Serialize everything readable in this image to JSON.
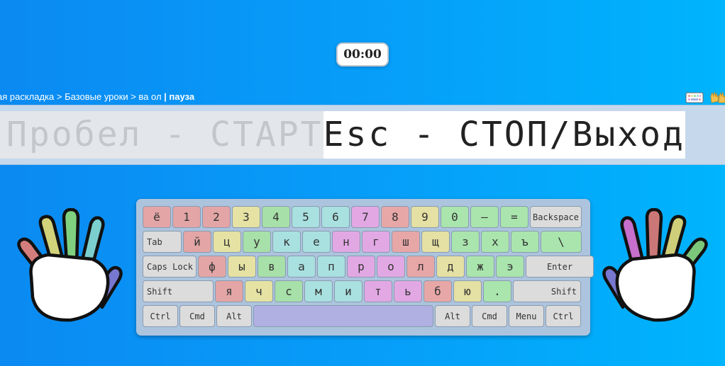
{
  "timer": "00:00",
  "breadcrumb": {
    "path": "кая раскладка > Базовые уроки > ва ол ",
    "separator": "| ",
    "state": "пауза"
  },
  "lesson": {
    "typed": "Пробел - СТАРТ ",
    "pending": "Esc - СТОП/Выход"
  },
  "finger_colors": {
    "pinky_left": "#e3a5a5",
    "ring_left": "#e5e2a3",
    "middle_left": "#a7e0a8",
    "index_left": "#a9e0e0",
    "index_right": "#e2a8e4",
    "middle_right": "#e7a7a7",
    "ring_right": "#e5e0a3",
    "pinky_right": "#a9e5ad",
    "thumb": "#b0b0e3",
    "fn": "#dcdcdc"
  },
  "keyboard": {
    "rows": [
      [
        {
          "label": "ё",
          "finger": "pinky_left"
        },
        {
          "label": "1",
          "finger": "pinky_left"
        },
        {
          "label": "2",
          "finger": "pinky_left"
        },
        {
          "label": "3",
          "finger": "ring_left"
        },
        {
          "label": "4",
          "finger": "middle_left"
        },
        {
          "label": "5",
          "finger": "index_left"
        },
        {
          "label": "6",
          "finger": "index_left"
        },
        {
          "label": "7",
          "finger": "index_right"
        },
        {
          "label": "8",
          "finger": "middle_right"
        },
        {
          "label": "9",
          "finger": "ring_right"
        },
        {
          "label": "0",
          "finger": "pinky_right"
        },
        {
          "label": "–",
          "finger": "pinky_right"
        },
        {
          "label": "=",
          "finger": "pinky_right"
        },
        {
          "label": "Backspace",
          "finger": "fn",
          "wide": true
        }
      ],
      [
        {
          "label": "Tab",
          "finger": "fn",
          "wide": true
        },
        {
          "label": "й",
          "finger": "pinky_left"
        },
        {
          "label": "ц",
          "finger": "ring_left"
        },
        {
          "label": "у",
          "finger": "middle_left"
        },
        {
          "label": "к",
          "finger": "index_left"
        },
        {
          "label": "е",
          "finger": "index_left"
        },
        {
          "label": "н",
          "finger": "index_right"
        },
        {
          "label": "г",
          "finger": "index_right"
        },
        {
          "label": "ш",
          "finger": "middle_right"
        },
        {
          "label": "щ",
          "finger": "ring_right"
        },
        {
          "label": "з",
          "finger": "pinky_right"
        },
        {
          "label": "х",
          "finger": "pinky_right"
        },
        {
          "label": "ъ",
          "finger": "pinky_right"
        },
        {
          "label": "\\",
          "finger": "pinky_right",
          "wide": true
        }
      ],
      [
        {
          "label": "Caps Lock",
          "finger": "fn",
          "wide": true
        },
        {
          "label": "ф",
          "finger": "pinky_left"
        },
        {
          "label": "ы",
          "finger": "ring_left"
        },
        {
          "label": "в",
          "finger": "middle_left"
        },
        {
          "label": "а",
          "finger": "index_left"
        },
        {
          "label": "п",
          "finger": "index_left"
        },
        {
          "label": "р",
          "finger": "index_right"
        },
        {
          "label": "о",
          "finger": "index_right"
        },
        {
          "label": "л",
          "finger": "middle_right"
        },
        {
          "label": "д",
          "finger": "ring_right"
        },
        {
          "label": "ж",
          "finger": "pinky_right"
        },
        {
          "label": "э",
          "finger": "pinky_right"
        },
        {
          "label": "Enter",
          "finger": "fn",
          "wide": true
        }
      ],
      [
        {
          "label": "Shift",
          "finger": "fn",
          "wide": true
        },
        {
          "label": "я",
          "finger": "pinky_left"
        },
        {
          "label": "ч",
          "finger": "ring_left"
        },
        {
          "label": "с",
          "finger": "middle_left"
        },
        {
          "label": "м",
          "finger": "index_left"
        },
        {
          "label": "и",
          "finger": "index_left"
        },
        {
          "label": "т",
          "finger": "index_right"
        },
        {
          "label": "ь",
          "finger": "index_right"
        },
        {
          "label": "б",
          "finger": "middle_right"
        },
        {
          "label": "ю",
          "finger": "ring_right"
        },
        {
          "label": ".",
          "finger": "pinky_right"
        },
        {
          "label": "Shift",
          "finger": "fn",
          "wide": true
        }
      ],
      [
        {
          "label": "Ctrl",
          "finger": "fn"
        },
        {
          "label": "Cmd",
          "finger": "fn"
        },
        {
          "label": "Alt",
          "finger": "fn"
        },
        {
          "label": "",
          "finger": "thumb",
          "wide": true
        },
        {
          "label": "Alt",
          "finger": "fn"
        },
        {
          "label": "Cmd",
          "finger": "fn"
        },
        {
          "label": "Menu",
          "finger": "fn"
        },
        {
          "label": "Ctrl",
          "finger": "fn"
        }
      ]
    ]
  },
  "icons": {
    "keyboard_toggle": "keyboard-icon",
    "hands_toggle": "hands-icon"
  }
}
